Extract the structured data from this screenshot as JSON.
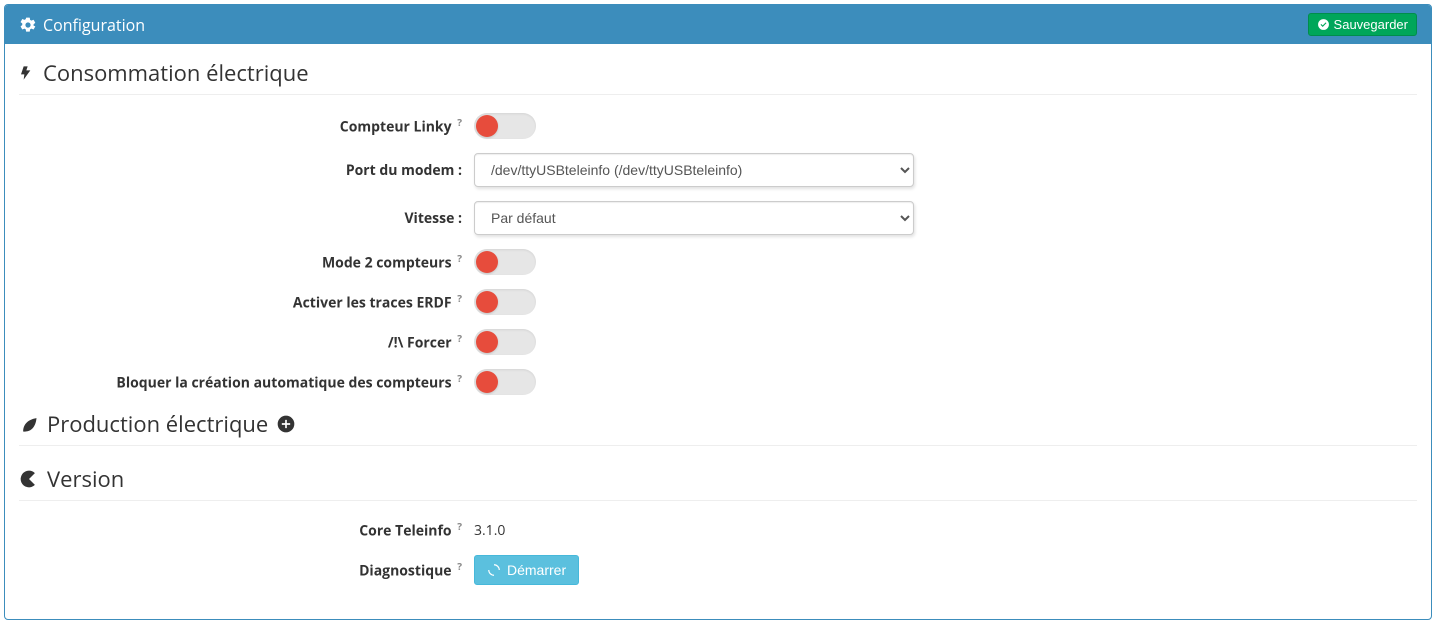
{
  "header": {
    "title": "Configuration",
    "save_label": "Sauvegarder"
  },
  "sections": {
    "consumption": {
      "title": "Consommation électrique",
      "fields": {
        "linky": {
          "label": "Compteur Linky"
        },
        "modem_port": {
          "label": "Port du modem :",
          "value": "/dev/ttyUSBteleinfo (/dev/ttyUSBteleinfo)",
          "options": [
            "/dev/ttyUSBteleinfo (/dev/ttyUSBteleinfo)"
          ]
        },
        "speed": {
          "label": "Vitesse :",
          "value": "Par défaut",
          "options": [
            "Par défaut"
          ]
        },
        "mode2": {
          "label": "Mode 2 compteurs"
        },
        "traces": {
          "label": "Activer les traces ERDF"
        },
        "force": {
          "label": "/!\\ Forcer"
        },
        "block_auto": {
          "label": "Bloquer la création automatique des compteurs"
        }
      }
    },
    "production": {
      "title": "Production électrique"
    },
    "version": {
      "title": "Version",
      "fields": {
        "core": {
          "label": "Core Teleinfo",
          "value": "3.1.0"
        },
        "diag": {
          "label": "Diagnostique",
          "button": "Démarrer"
        }
      }
    }
  }
}
